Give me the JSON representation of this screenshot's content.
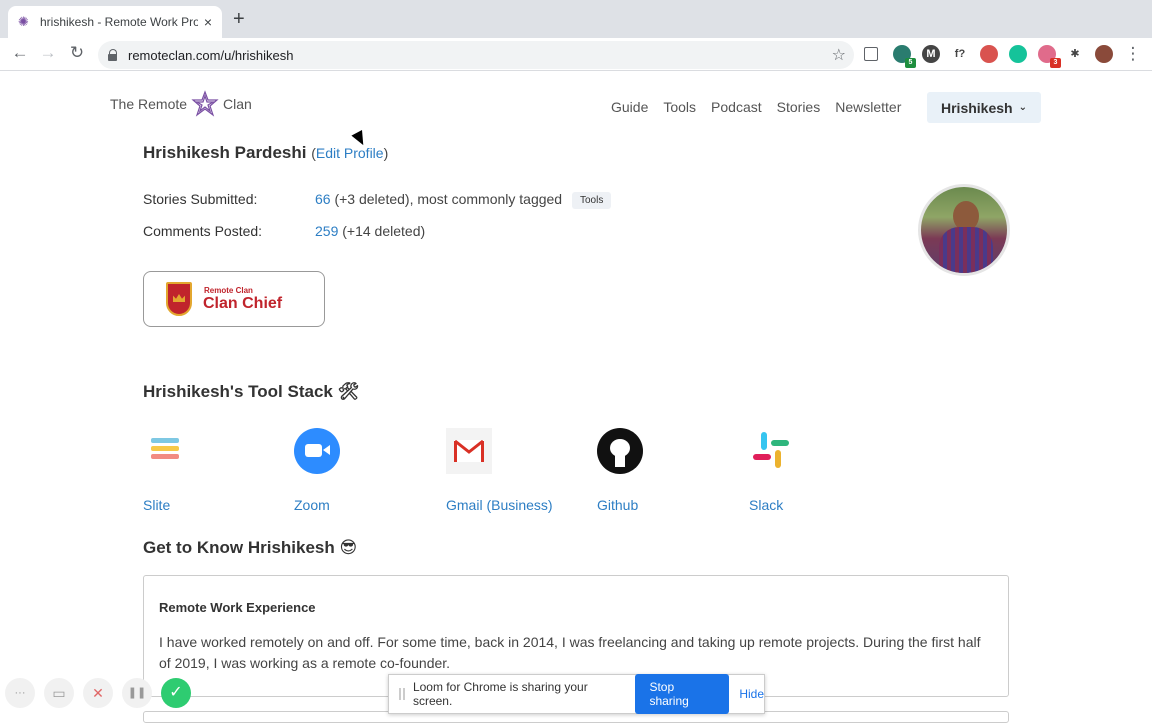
{
  "browser": {
    "tab_title": "hrishikesh - Remote Work Profile",
    "tab_close": "×",
    "new_tab": "+",
    "url": "remoteclan.com/u/hrishikesh",
    "back": "←",
    "forward": "→",
    "reload": "↻",
    "star": "☆",
    "extensions": [
      {
        "name": "extension-globe-icon",
        "glyph": "",
        "color": "#2a7c6f",
        "badge": "5",
        "badge_color": "#1e8e3e"
      },
      {
        "name": "extension-m-icon",
        "glyph": "M",
        "color": "#444444"
      },
      {
        "name": "extension-f-icon",
        "glyph": "f?",
        "color": "#ffffff"
      },
      {
        "name": "extension-chrome-icon",
        "glyph": "",
        "color": "#d9534f"
      },
      {
        "name": "extension-grammarly-icon",
        "glyph": "",
        "color": "#15c39a"
      },
      {
        "name": "extension-pink-icon",
        "glyph": "",
        "color": "#e06b8b",
        "badge": "3",
        "badge_color": "#d93025"
      },
      {
        "name": "extensions-puzzle-icon",
        "glyph": "✱",
        "color": "#ffffff"
      },
      {
        "name": "profile-avatar-icon",
        "glyph": "",
        "color": "#8a4a3a"
      }
    ],
    "menu": "⋮"
  },
  "site": {
    "logo_left": "The Remote",
    "logo_right": "Clan",
    "nav": [
      "Guide",
      "Tools",
      "Podcast",
      "Stories",
      "Newsletter"
    ],
    "user_menu": "Hrishikesh"
  },
  "profile": {
    "name": "Hrishikesh Pardeshi",
    "edit_open": "(",
    "edit_label": "Edit Profile",
    "edit_close": ")",
    "stories_label": "Stories Submitted:",
    "stories_count": "66",
    "stories_rest": " (+3 deleted), most commonly tagged",
    "stories_tag": "Tools",
    "comments_label": "Comments Posted:",
    "comments_count": "259",
    "comments_rest": " (+14 deleted)",
    "badge_small": "Remote Clan",
    "badge_big": "Clan Chief"
  },
  "tool_stack": {
    "title": "Hrishikesh's Tool Stack 🛠",
    "tools": [
      {
        "name": "Slite"
      },
      {
        "name": "Zoom"
      },
      {
        "name": "Gmail (Business)"
      },
      {
        "name": "Github"
      },
      {
        "name": "Slack"
      }
    ]
  },
  "know": {
    "title": "Get to Know Hrishikesh 😎",
    "card_heading": "Remote Work Experience",
    "card_body": "I have worked remotely on and off. For some time, back in 2014, I was freelancing and taking up remote projects. During the first half of 2019, I was working as a remote co-founder."
  },
  "loom": {
    "more": "···",
    "camera": "▭",
    "cancel": "✕",
    "pause": "❚❚",
    "done": "✓",
    "message": "Loom for Chrome is sharing your screen.",
    "stop_label": "Stop sharing",
    "hide_label": "Hide"
  }
}
